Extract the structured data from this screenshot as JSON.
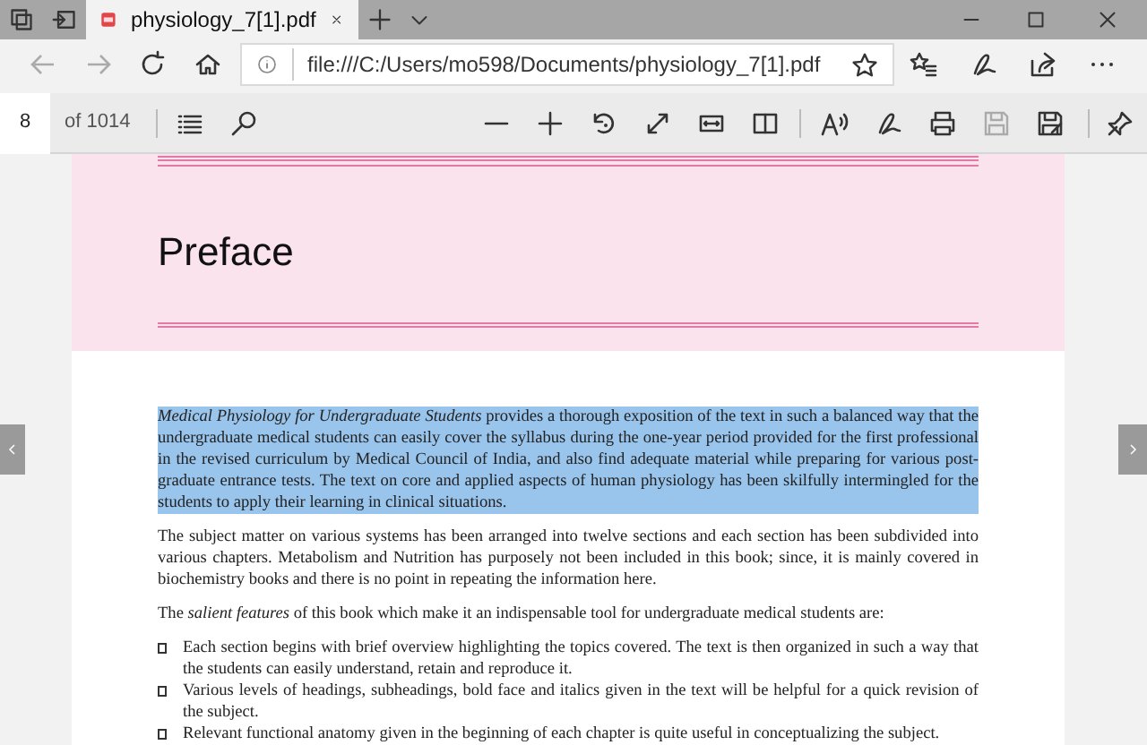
{
  "tabs": [
    {
      "title": "physiology_7[1].pdf",
      "selected": true
    }
  ],
  "address_bar": {
    "url": "file:///C:/Users/mo598/Documents/physiology_7[1].pdf"
  },
  "pdf_toolbar": {
    "page_number": "8",
    "page_count": "of 1014"
  },
  "document": {
    "heading": "Preface",
    "paragraphs": [
      {
        "text": "*Medical Physiology for Undergraduate Students* provides a thorough exposition of the text in such a balanced way that the undergraduate medical students can easily cover the syllabus during the one-year period provided for the first professional in the revised curriculum by Medical Council of India, and also find adequate material while preparing for various post-graduate entrance tests. The text on core and applied aspects of human physiology has been skilfully intermingled for the students to apply their learning in clinical situations.",
        "selected": true
      },
      {
        "text": "The subject matter on various systems has been arranged into twelve sections and each section has been subdivided into various chapters. Metabolism and Nutrition has purposely not been included in this book; since, it is mainly covered in biochemistry books and there is no point in repeating the information here.",
        "selected": false
      },
      {
        "text": "The *salient features* of this book which make it an indispensable tool for undergraduate medical students are:",
        "selected": false
      }
    ],
    "bullets": [
      "Each section begins with brief overview highlighting the topics covered. The text is then organized in such a way that the students can easily understand, retain and reproduce it.",
      "Various levels of headings, subheadings, bold face and italics given in the text will be helpful for a quick revision of the subject.",
      "Relevant functional anatomy given in the beginning of each chapter is quite useful in conceptualizing the subject."
    ]
  }
}
